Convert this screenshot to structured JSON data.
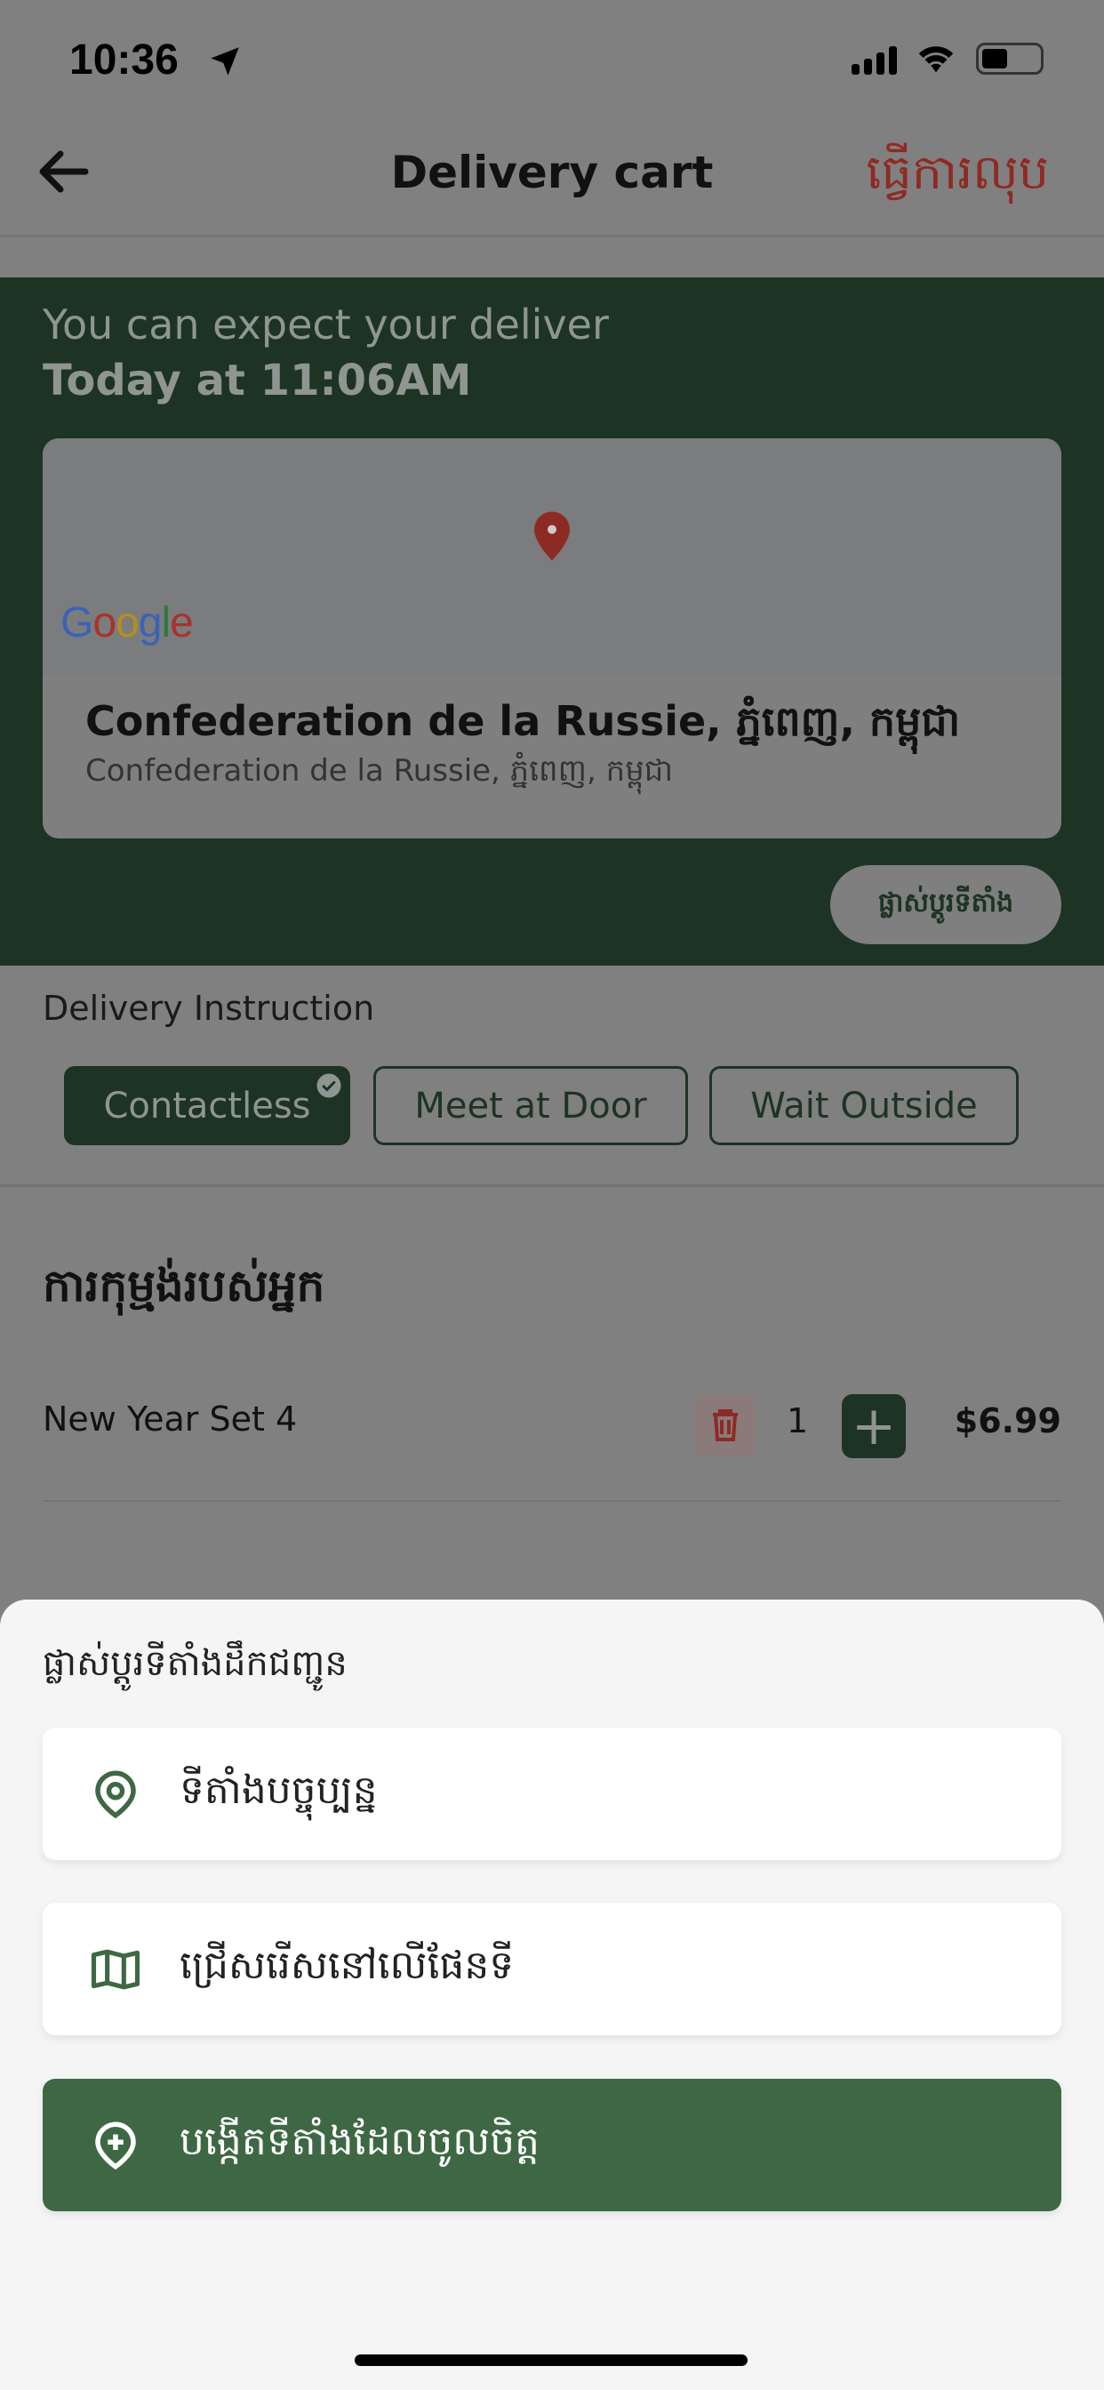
{
  "status_bar": {
    "time": "10:36"
  },
  "header": {
    "title": "Delivery cart",
    "action_label": "ធ្វើការលុប"
  },
  "delivery": {
    "eta_line1": "You can expect your deliver",
    "eta_line2": "Today at 11:06AM",
    "map_logo": "Google",
    "address_title": "Confederation de la Russie, ភ្នំពេញ, កម្ពុជា",
    "address_subtitle": "Confederation de la Russie, ភ្នំពេញ, កម្ពុជា",
    "change_location_label": "ផ្លាស់ប្តូរទីតាំង"
  },
  "instruction": {
    "label": "Delivery Instruction",
    "options": [
      {
        "label": "Contactless",
        "selected": true
      },
      {
        "label": "Meet at Door",
        "selected": false
      },
      {
        "label": "Wait Outside",
        "selected": false
      }
    ]
  },
  "orders": {
    "heading": "ការកុម្មង់របស់អ្នក",
    "items": [
      {
        "name": "New Year Set 4",
        "quantity": "1",
        "price": "$6.99"
      }
    ]
  },
  "sheet": {
    "title": "ផ្លាស់ប្តូរទីតាំងដឹកជញ្ជូន",
    "options": [
      {
        "label": "ទីតាំងបច្ចុប្បន្ន",
        "icon": "location-pin-icon"
      },
      {
        "label": "ជ្រើសរើសនៅលើផែនទី",
        "icon": "map-icon"
      },
      {
        "label": "បង្កើតទីតាំងដែលចូលចិត្ត",
        "icon": "add-location-icon"
      }
    ]
  },
  "colors": {
    "brand_green": "#3e6844",
    "dark_green": "#1d3324",
    "danger": "#8e2a24"
  }
}
